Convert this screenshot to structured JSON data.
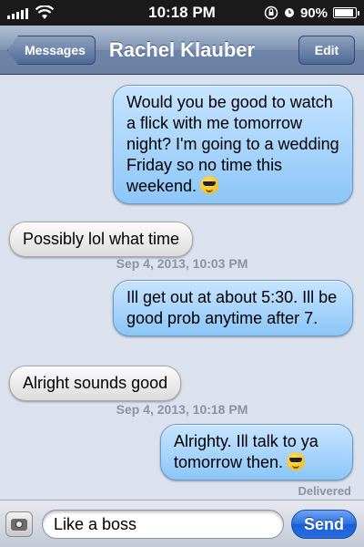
{
  "status": {
    "time": "10:18 PM",
    "battery": "90%",
    "battery_level": 0.9
  },
  "nav": {
    "back_label": "Messages",
    "title": "Rachel Klauber",
    "edit_label": "Edit"
  },
  "messages": [
    {
      "direction": "out",
      "text": "Would you be good to watch a flick with me tomorrow night? I'm going to a wedding Friday so no time this weekend.",
      "emoji": "sunglasses-emoji"
    },
    {
      "direction": "in",
      "text": "Possibly lol what time"
    },
    {
      "direction": "out",
      "text": "Ill get out at about 5:30. Ill be good prob anytime after 7."
    },
    {
      "direction": "in",
      "text": "Alright sounds good"
    },
    {
      "direction": "out",
      "text": "Alrighty. Ill talk to ya tomorrow then.",
      "emoji": "sunglasses-emoji"
    }
  ],
  "timestamps": [
    "Sep 4, 2013, 10:03 PM",
    "Sep 4, 2013, 10:18 PM"
  ],
  "delivered_label": "Delivered",
  "composer": {
    "value": "Like a boss",
    "send_label": "Send"
  },
  "colors": {
    "outgoing_bubble": "#8cc6f7",
    "incoming_bubble": "#e6e6e6",
    "send_button": "#2b6fe0",
    "background": "#dbe2ed"
  }
}
